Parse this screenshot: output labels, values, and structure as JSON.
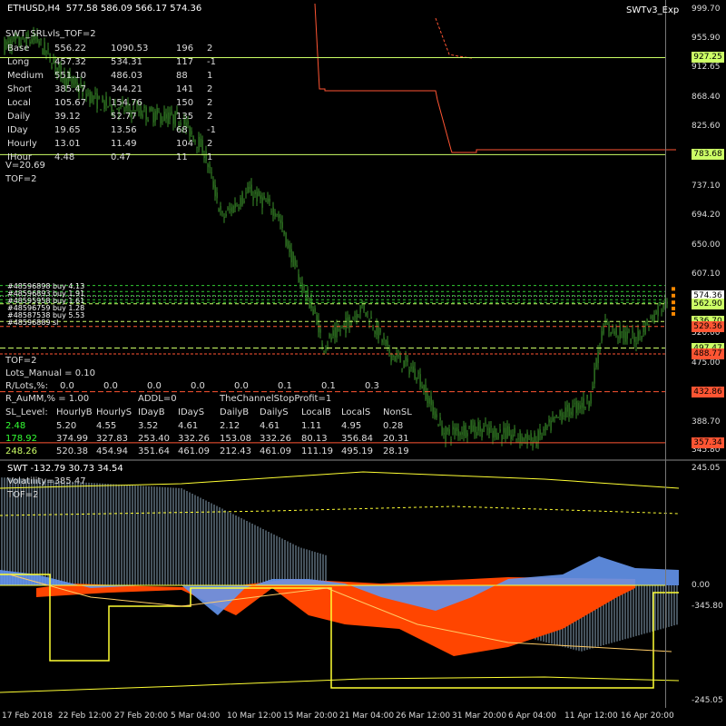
{
  "header": {
    "symbol_info": "ETHUSD,H4  577.58 586.09 566.17 574.36",
    "expert": "SWTv3_Exp",
    "levels_title": "SWT_SRLvls_TOF=2"
  },
  "levels_table": [
    [
      "Base",
      "556.22",
      "1090.53",
      "196",
      "2"
    ],
    [
      "Long",
      "457.32",
      "534.31",
      "117",
      "-1"
    ],
    [
      "Medium",
      "551.10",
      "486.03",
      "88",
      "1"
    ],
    [
      "Short",
      "385.47",
      "344.21",
      "141",
      "2"
    ],
    [
      "Local",
      "105.67",
      "154.76",
      "150",
      "2"
    ],
    [
      "Daily",
      "39.12",
      "52.77",
      "135",
      "2"
    ],
    [
      "IDay",
      "19.65",
      "13.56",
      "68",
      "-1"
    ],
    [
      "Hourly",
      "13.01",
      "11.49",
      "104",
      "2"
    ],
    [
      "IHour",
      "4.48",
      "0.47",
      "11",
      "1"
    ]
  ],
  "mid": {
    "v": "V=20.69",
    "tof": "TOF=2"
  },
  "orders": [
    "#48596898 buy 4.13",
    "#48596893 buy 1.91",
    "#48595958 buy 1.61",
    "#48596759 buy 1.28",
    "#48587538 buy 5.53",
    "#48596889 sl"
  ],
  "panel": {
    "tof": "TOF=2",
    "lots_manual": "Lots_Manual = 0.10",
    "rlots_label": "R/Lots,%:",
    "rlots_values": [
      "0.0",
      "0.0",
      "0.0",
      "0.0",
      "0.0",
      "0.1",
      "0.1",
      "0.3"
    ],
    "r_aumm": "R_AuMM,% = 1.00",
    "addl": "ADDL=0",
    "channel_stop": "TheChannelStopProfit=1",
    "sl_header": [
      "SL_Level:",
      "HourlyB",
      "HourlyS",
      "IDayB",
      "IDayS",
      "DailyB",
      "DailyS",
      "LocalB",
      "LocalS",
      "NonSL"
    ],
    "sl_rows": [
      {
        "lead": "2.48",
        "values": [
          "5.20",
          "4.55",
          "3.52",
          "4.61",
          "2.12",
          "4.61",
          "1.11",
          "4.95",
          "0.28"
        ]
      },
      {
        "lead": "178.92",
        "values": [
          "374.99",
          "327.83",
          "253.40",
          "332.26",
          "153.08",
          "332.26",
          "80.13",
          "356.84",
          "20.31"
        ]
      },
      {
        "lead": "248.26",
        "values": [
          "520.38",
          "454.94",
          "351.64",
          "461.09",
          "212.43",
          "461.09",
          "111.19",
          "495.19",
          "28.19"
        ]
      }
    ]
  },
  "price_axis": [
    {
      "label": "999.70",
      "price": 999.7
    },
    {
      "label": "955.90",
      "price": 955.9
    },
    {
      "label": "912.65",
      "price": 912.65
    },
    {
      "label": "868.40",
      "price": 868.4
    },
    {
      "label": "825.60",
      "price": 825.6
    },
    {
      "label": "737.10",
      "price": 737.1
    },
    {
      "label": "694.20",
      "price": 694.2
    },
    {
      "label": "650.00",
      "price": 650.0
    },
    {
      "label": "607.10",
      "price": 607.1
    },
    {
      "label": "520.00",
      "price": 520.0
    },
    {
      "label": "475.00",
      "price": 475.0
    },
    {
      "label": "388.70",
      "price": 388.7
    },
    {
      "label": "345.80",
      "price": 345.8
    }
  ],
  "price_tags": [
    {
      "label": "927.25",
      "price": 927.25,
      "color": "#ccff66"
    },
    {
      "label": "783.68",
      "price": 783.68,
      "color": "#ccff66"
    },
    {
      "label": "574.36",
      "price": 574.36,
      "color": "#ffffff"
    },
    {
      "label": "562.90",
      "price": 562.9,
      "color": "#ccff66"
    },
    {
      "label": "536.70",
      "price": 536.7,
      "color": "#ccff66"
    },
    {
      "label": "529.36",
      "price": 529.36,
      "color": "#ff5533"
    },
    {
      "label": "497.47",
      "price": 497.47,
      "color": "#ccff66"
    },
    {
      "label": "488.77",
      "price": 488.77,
      "color": "#ff5533"
    },
    {
      "label": "432.86",
      "price": 432.86,
      "color": "#ff5533"
    },
    {
      "label": "357.34",
      "price": 357.34,
      "color": "#ff5533"
    }
  ],
  "sub": {
    "title": "SWT -132.79 30.73 34.54",
    "volatility": "Volatility=385.47",
    "tof": "TOF=2",
    "axis": [
      {
        "label": "245.05",
        "value": 245.05
      },
      {
        "label": "0.00",
        "value": 0
      },
      {
        "label": "-345.80",
        "value": -345.8
      },
      {
        "label": "-245.05",
        "value": -245.05
      }
    ]
  },
  "time_axis": [
    "17 Feb 2018",
    "22 Feb 12:00",
    "27 Feb 20:00",
    "5 Mar 04:00",
    "10 Mar 12:00",
    "15 Mar 20:00",
    "21 Mar 04:00",
    "26 Mar 12:00",
    "31 Mar 20:00",
    "6 Apr 04:00",
    "11 Apr 12:00",
    "16 Apr 20:00"
  ],
  "colors": {
    "candles": "#3a8f2a",
    "support_line": "#ccff66",
    "resistance_line": "#ff5533",
    "histogram_blue": "#6495ed",
    "histogram_orange": "#ff4500",
    "channel_yellow": "#ffff33"
  }
}
